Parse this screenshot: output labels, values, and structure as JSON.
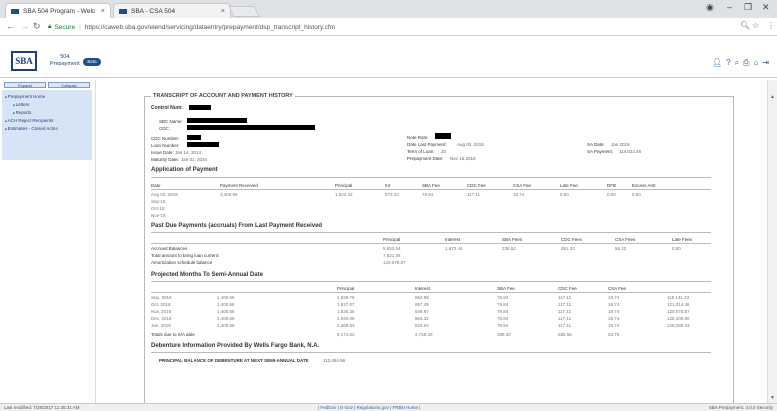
{
  "browser": {
    "tabs": [
      {
        "label": "SBA 504 Program - Welc"
      },
      {
        "label": "SBA - CSA 504"
      }
    ],
    "secure_label": "Secure",
    "url": "https://caweb.sba.gov/elend/servicing/dataentry/prepayment/dsp_transcript_history.cfm"
  },
  "header": {
    "logo": "SBA",
    "app_name_line1": "504",
    "app_name_line2": "Prepayment",
    "badge": "Beta"
  },
  "sidebar": {
    "expand": "Expand",
    "collapse": "Collapse",
    "items": [
      {
        "label": "Prepayment Home",
        "level": 0
      },
      {
        "label": "Letters",
        "level": 1
      },
      {
        "label": "Reports",
        "level": 1
      },
      {
        "label": "ACH Reject Recipients",
        "level": 0
      },
      {
        "label": "Estimates - Closed Actns",
        "level": 0
      }
    ]
  },
  "transcript": {
    "title": "TRANSCRIPT OF ACCOUNT AND PAYMENT HISTORY",
    "control_num_label": "Control Num:",
    "info_left": [
      {
        "label": "SBC Name:"
      },
      {
        "label": "CDC:"
      },
      {
        "label": "CDC Number:"
      },
      {
        "label": "Loan Number:"
      },
      {
        "label": "Issue Date:",
        "value": "Jan 14, 2014"
      },
      {
        "label": "Maturity Date:",
        "value": "Jan 01, 2034"
      }
    ],
    "info_mid": [
      {
        "label": "Note Rate:"
      },
      {
        "label": "Date Last Payment:",
        "value": "Aug 02, 2018"
      },
      {
        "label": "Term of Loan:",
        "value": "20"
      },
      {
        "label": "Prepayment Date:",
        "value": "Nov 15,2018"
      }
    ],
    "info_right": [
      {
        "label": "SA Date:",
        "value": "Jan 2019"
      },
      {
        "label": "SA Payment:",
        "value": "114,023.46"
      }
    ],
    "application": {
      "title": "Application of Payment",
      "headers": [
        "Date",
        "Payment Received",
        "Principal",
        "Int",
        "SBA Fee",
        "CDC Fee",
        "CSA Fee",
        "Late Fee",
        "DFB",
        "Excess Amt"
      ],
      "rows": [
        [
          "Aug 02, 2018",
          "3,400.66",
          "1,922.43",
          "873.43",
          "79.84",
          "117.11",
          "18.74",
          "0.00",
          "0.00",
          "0.00"
        ],
        [
          "Sep-18"
        ],
        [
          "Oct-18"
        ],
        [
          "Nov-18"
        ]
      ]
    },
    "past_due": {
      "title": "Past Due Payments (accruals) From Last Payment Received",
      "headers": [
        "Principal",
        "Interest",
        "SBA Fees",
        "CDC Fees",
        "CSA Fees",
        "Late Fees"
      ],
      "rows": [
        {
          "label": "Accrued Balances",
          "values": [
            "5,653.54",
            "1,672.44",
            "239.52",
            "351.33",
            "56.22",
            "0.00"
          ]
        },
        {
          "label": "Total amount to bring loan current:",
          "values": [
            "7,821.36"
          ]
        },
        {
          "label": "Amortization schedule balance",
          "values": [
            "120,078.87"
          ]
        }
      ]
    },
    "projected": {
      "title": "Projected Months To Semi-Annual Date",
      "headers": [
        "Principal",
        "Interest",
        "SBA Fee",
        "CDC Fee",
        "CSA Fee"
      ],
      "rows": [
        [
          "Sep, 2018",
          "1,400.66",
          "1,929.76",
          "863.98",
          "79.84",
          "117.11",
          "18.74",
          "118,141.43"
        ],
        [
          "Oct, 2018",
          "1,400.66",
          "1,927.07",
          "867.49",
          "79.84",
          "117.11",
          "18.74",
          "121,014.36"
        ],
        [
          "Nov, 2018",
          "1,400.66",
          "1,826.35",
          "849.97",
          "79.84",
          "117.11",
          "18.74",
          "120,078.87"
        ],
        [
          "Dec, 2018",
          "1,400.66",
          "1,940.06",
          "863.32",
          "79.84",
          "117.11",
          "18.74",
          "128,100.90"
        ],
        [
          "Jan, 2019",
          "1,400.66",
          "1,369.53",
          "834.04",
          "79.84",
          "117.11",
          "18.74",
          "128,389.33"
        ]
      ],
      "totals": [
        "Totals due to S/A date",
        "9,174.62",
        "2,748.20",
        "399.20",
        "585.55",
        "93.70"
      ]
    },
    "debenture": {
      "title": "Debenture Information Provided By Wells Fargo Bank, N.A.",
      "line_label": "PRINCIPAL BALANCE OF DEBENTURE AT NEXT SEMI-ANNUAL DATE",
      "line_value": "113,454.96"
    }
  },
  "status": {
    "left": "Last modified: 7/28/2017 11:35:31 AM",
    "center": "| FedGov | E-Gov | Regulations.gov | FRBN Home |",
    "right": "SBA Prepayment. 4.0.0 Security"
  }
}
